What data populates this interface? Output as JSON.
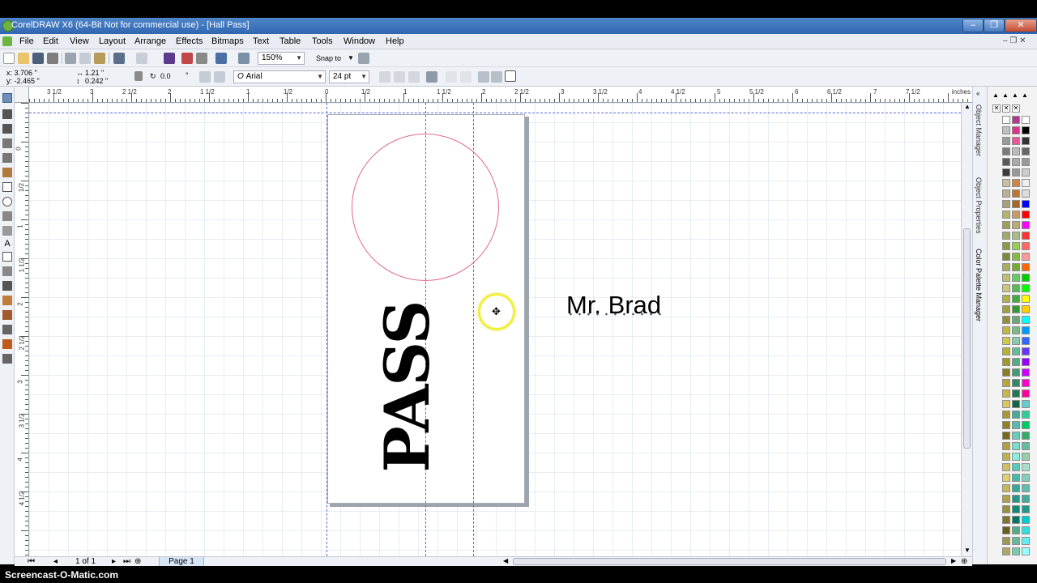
{
  "window": {
    "title": "CorelDRAW X6 (64-Bit Not for commercial use) - [Hall Pass]",
    "min": "–",
    "max": "❐",
    "close": "✕"
  },
  "menu": {
    "items": [
      "File",
      "Edit",
      "View",
      "Layout",
      "Arrange",
      "Effects",
      "Bitmaps",
      "Text",
      "Table",
      "Tools",
      "Window",
      "Help"
    ],
    "doc_controls": "– ❐ ✕"
  },
  "standard_toolbar": {
    "zoom": "150%",
    "snap_to": "Snap to"
  },
  "property_bar": {
    "x": "x: 3.706 \"",
    "y": "y: -2.465 \"",
    "width": "1.21 \"",
    "height": "0.242 \"",
    "rotation": "0.0",
    "degree": "°",
    "font": "Arial",
    "font_size": "24 pt"
  },
  "ruler": {
    "units": "inches",
    "top_labels": [
      "3 1/2",
      "3",
      "2 1/2",
      "2",
      "1 1/2",
      "1",
      "1/2",
      "0",
      "1/2",
      "1",
      "1 1/2",
      "2",
      "2 1/2",
      "3",
      "3 1/2",
      "4",
      "4 1/2",
      "5",
      "5 1/2",
      "6",
      "6 1/2",
      "7",
      "7 1/2"
    ],
    "left_labels": [
      "0",
      "1/2",
      "1",
      "1 1/2",
      "2",
      "2 1/2",
      "3",
      "3 1/2",
      "4",
      "4 1/2"
    ]
  },
  "canvas": {
    "pass_text": "PASS",
    "name_text": "Mr. Brad",
    "move_cursor": "✥"
  },
  "status": {
    "page_count": "1 of 1",
    "page_tab": "Page 1",
    "nav_first": "⏮",
    "nav_prev": "◂",
    "nav_next": "▸",
    "nav_last": "⏭"
  },
  "dockers": {
    "object_manager": "Object Manager",
    "object_properties": "Object Properties",
    "color_palette_manager": "Color Palette Manager"
  },
  "colors": {
    "title_bar": "#3a72bd",
    "circle_outline": "#e06a90",
    "guide": "#5a6bd6",
    "cursor_highlight": "#f2ef3a"
  },
  "watermark": "Screencast-O-Matic.com"
}
